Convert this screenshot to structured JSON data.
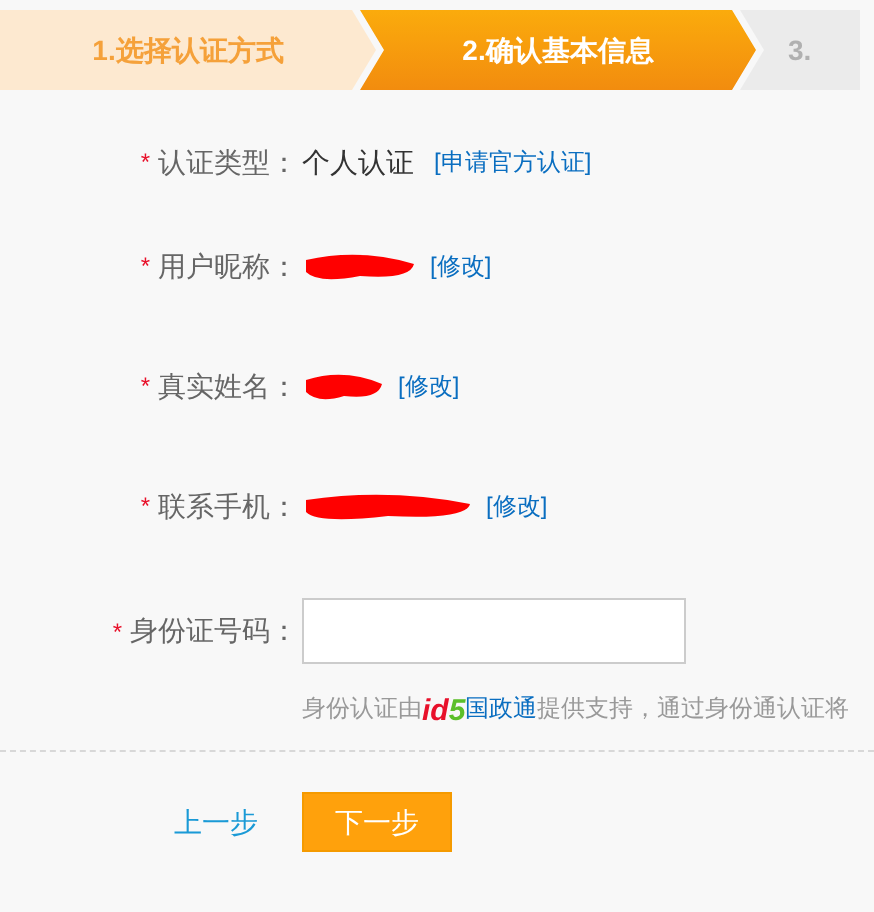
{
  "steps": [
    {
      "label": "1.选择认证方式",
      "selected": false
    },
    {
      "label": "2.确认基本信息",
      "selected": true
    },
    {
      "label": "3.",
      "selected": false
    }
  ],
  "fields": [
    {
      "kind": "text",
      "required_mark": "*",
      "label": "认证类型：",
      "value": "个人认证",
      "link": "[申请官方认证]"
    },
    {
      "kind": "redacted",
      "required_mark": "*",
      "label": "用户昵称：",
      "link": "[修改]"
    },
    {
      "kind": "redacted",
      "required_mark": "*",
      "label": "真实姓名：",
      "link": "[修改]"
    },
    {
      "kind": "redacted",
      "required_mark": "*",
      "label": "联系手机：",
      "link": "[修改]"
    },
    {
      "kind": "input",
      "required_mark": "*",
      "label": "身份证号码："
    }
  ],
  "hint": {
    "before": "身份认证由",
    "logo": [
      {
        "text": "i",
        "color": "#e8102a"
      },
      {
        "text": "d",
        "color": "#e8102a"
      },
      {
        "text": "5",
        "color": "#5cbf2a"
      }
    ],
    "provider": "国政通",
    "after": "提供支持，通过身份通认证将"
  },
  "buttons": {
    "back": "上一步",
    "next": "下一步"
  }
}
